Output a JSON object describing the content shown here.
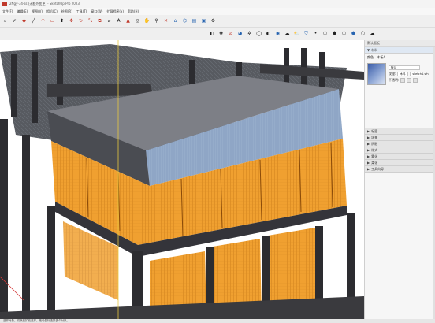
{
  "window": {
    "title": "2Ngy-34-ss (无额外变更) - SketchUp Pro 2023"
  },
  "menu": {
    "items": [
      "文件(F)",
      "编辑(E)",
      "视图(V)",
      "相机(C)",
      "绘图(R)",
      "工具(T)",
      "窗口(W)",
      "扩展程序(x)",
      "帮助(H)"
    ]
  },
  "viewport": {
    "colors": {
      "concrete": "#2c2c30",
      "concrete_top": "#6e6e72",
      "formwork": "#f0a030",
      "formwork_dark": "#c97a12",
      "slab_side": "#8ba3c6",
      "axis_red": "#d43a3a",
      "axis_green": "#3aa04a",
      "axis_blue": "#3a5bd4"
    }
  },
  "tray": {
    "title": "默认面板",
    "materials_header": "材料",
    "material_name_label": "颜色:",
    "material_name": "木板4",
    "default_label": "默认",
    "texture_label": "纹理:",
    "texture_value": "木料",
    "texture_file": "sketch1.wh",
    "opacity_label": "不透明:",
    "collapsed_panels": [
      "标签",
      "场景",
      "阴影",
      "样式",
      "雾化",
      "柔化",
      "工具向导"
    ]
  },
  "statusbar": {
    "text": "选择对象。切换到扩充选择。拖动鼠标选择多个对象。"
  }
}
